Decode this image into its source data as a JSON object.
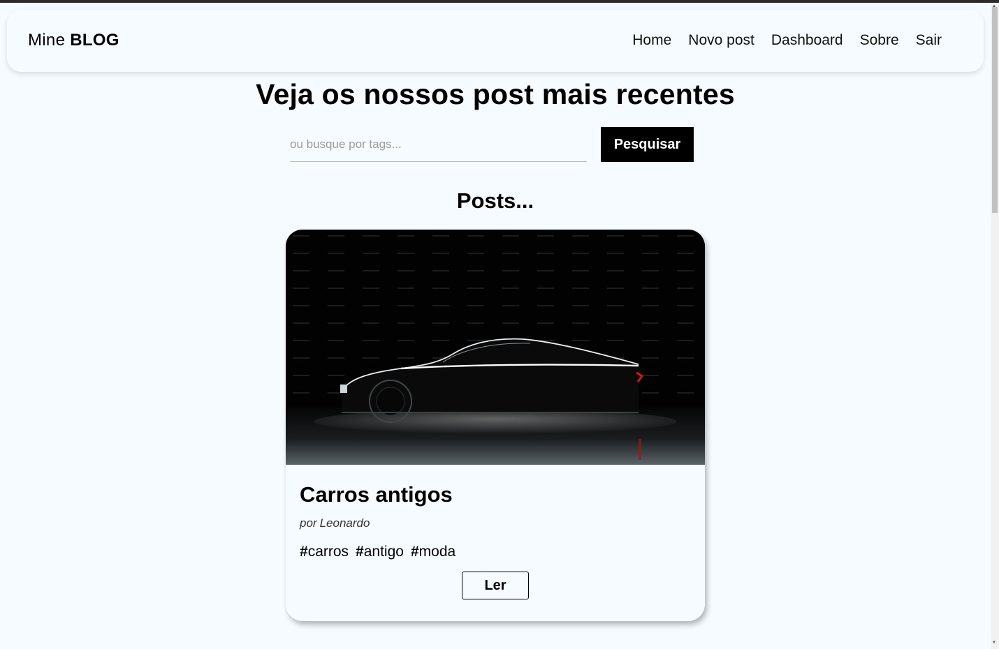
{
  "brand": {
    "light": "Mine",
    "bold": "BLOG"
  },
  "nav": {
    "items": [
      {
        "label": "Home"
      },
      {
        "label": "Novo post"
      },
      {
        "label": "Dashboard"
      },
      {
        "label": "Sobre"
      },
      {
        "label": "Sair"
      }
    ]
  },
  "main": {
    "headline": "Veja os nossos post mais recentes",
    "search": {
      "value": "",
      "placeholder": "ou busque por tags...",
      "button_label": "Pesquisar"
    },
    "posts_title": "Posts..."
  },
  "post": {
    "image_icon": "car-silhouette-image",
    "title": "Carros antigos",
    "author_prefix": "por",
    "author": "Leonardo",
    "tags": [
      "carros",
      "antigo",
      "moda"
    ],
    "read_label": "Ler"
  },
  "colors": {
    "background": "#f5fbff",
    "button_bg": "#000000",
    "button_text": "#ffffff"
  }
}
